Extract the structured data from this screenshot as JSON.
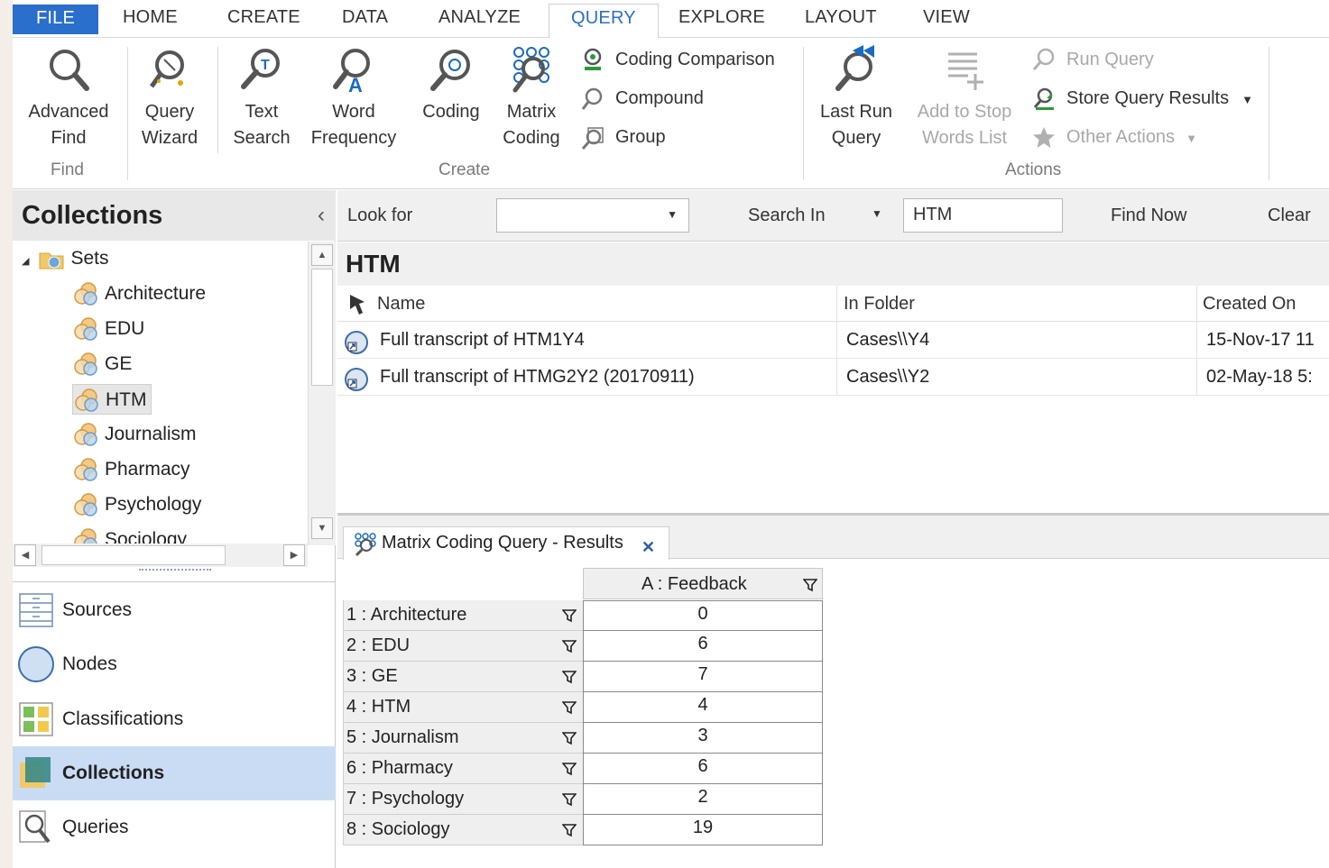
{
  "ribbon_tabs": [
    "FILE",
    "HOME",
    "CREATE",
    "DATA",
    "ANALYZE",
    "QUERY",
    "EXPLORE",
    "LAYOUT",
    "VIEW"
  ],
  "ribbon": {
    "find": {
      "advanced_find_l1": "Advanced",
      "advanced_find_l2": "Find",
      "group": "Find"
    },
    "create": {
      "query_wizard_l1": "Query",
      "query_wizard_l2": "Wizard",
      "text_search_l1": "Text",
      "text_search_l2": "Search",
      "word_frequency_l1": "Word",
      "word_frequency_l2": "Frequency",
      "coding": "Coding",
      "matrix_coding_l1": "Matrix",
      "matrix_coding_l2": "Coding",
      "coding_comparison": "Coding Comparison",
      "compound": "Compound",
      "group_btn": "Group",
      "group": "Create"
    },
    "actions": {
      "last_run_l1": "Last Run",
      "last_run_l2": "Query",
      "add_stop_l1": "Add to Stop",
      "add_stop_l2": "Words List",
      "run_query": "Run Query",
      "store_results": "Store Query Results",
      "other_actions": "Other Actions",
      "group": "Actions"
    }
  },
  "collections": {
    "title": "Collections",
    "root": "Sets",
    "items": [
      "Architecture",
      "EDU",
      "GE",
      "HTM",
      "Journalism",
      "Pharmacy",
      "Psychology",
      "Sociology"
    ],
    "selected": "HTM"
  },
  "nav": [
    "Sources",
    "Nodes",
    "Classifications",
    "Collections",
    "Queries"
  ],
  "nav_active": "Collections",
  "findbar": {
    "look_for": "Look for",
    "look_for_value": "",
    "search_in": "Search In",
    "search_value": "HTM",
    "find_now": "Find Now",
    "clear": "Clear"
  },
  "list": {
    "title": "HTM",
    "columns": [
      "Name",
      "In Folder",
      "Created On"
    ],
    "rows": [
      {
        "name": "Full transcript of HTM1Y4",
        "folder": "Cases\\\\Y4",
        "created": "15-Nov-17 11"
      },
      {
        "name": "Full transcript of HTMG2Y2 (20170911)",
        "folder": "Cases\\\\Y2",
        "created": "02-May-18 5:"
      }
    ]
  },
  "results": {
    "tab_label": "Matrix Coding Query - Results",
    "column": "A : Feedback",
    "rows": [
      {
        "label": "1 : Architecture",
        "value": "0"
      },
      {
        "label": "2 : EDU",
        "value": "6"
      },
      {
        "label": "3 : GE",
        "value": "7"
      },
      {
        "label": "4 : HTM",
        "value": "4"
      },
      {
        "label": "5 : Journalism",
        "value": "3"
      },
      {
        "label": "6 : Pharmacy",
        "value": "6"
      },
      {
        "label": "7 : Psychology",
        "value": "2"
      },
      {
        "label": "8 : Sociology",
        "value": "19"
      }
    ]
  },
  "colors": {
    "accent": "#2a6fcc",
    "nav_active": "#c9dcf4",
    "ribbon_bg": "#ffffff"
  }
}
